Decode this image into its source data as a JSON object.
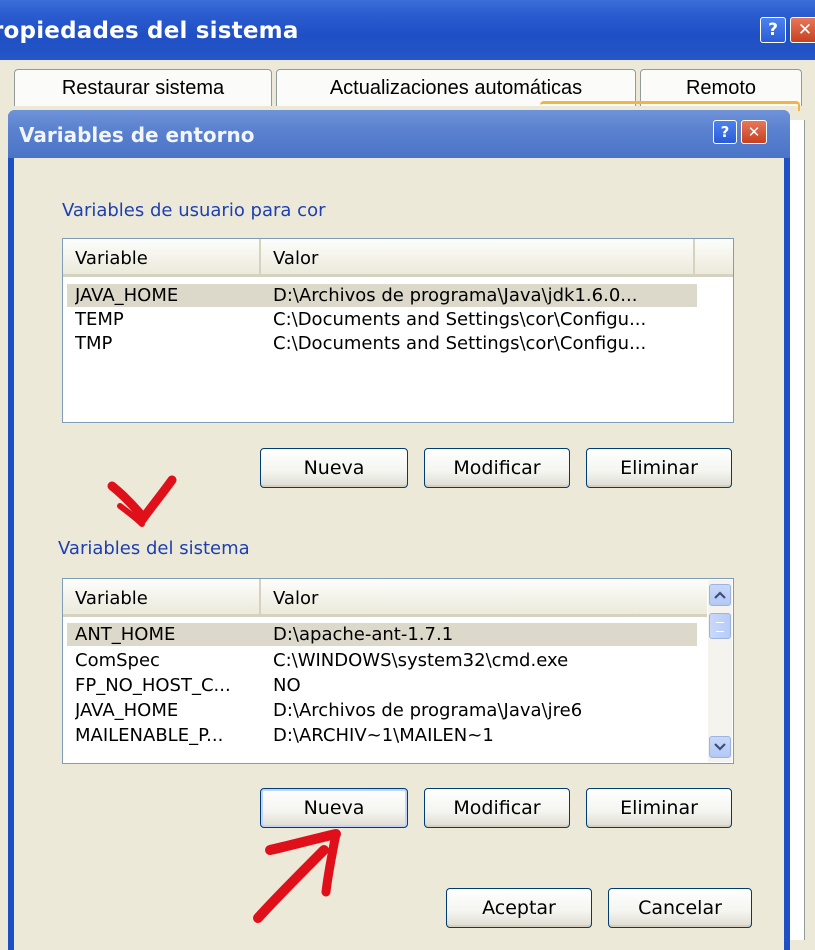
{
  "outer_window": {
    "title": "ropiedades del sistema",
    "help_glyph": "?",
    "close_glyph": "✕",
    "tabs": [
      {
        "label": "Restaurar sistema"
      },
      {
        "label": "Actualizaciones automáticas"
      },
      {
        "label": "Remoto"
      }
    ]
  },
  "dialog": {
    "title": "Variables de entorno",
    "help_glyph": "?",
    "close_glyph": "✕",
    "user_section": {
      "label": "Variables de usuario para cor",
      "columns": [
        "Variable",
        "Valor"
      ],
      "rows": [
        {
          "variable": "JAVA_HOME",
          "valor": "D:\\Archivos de programa\\Java\\jdk1.6.0...",
          "selected": true
        },
        {
          "variable": "TEMP",
          "valor": "C:\\Documents and Settings\\cor\\Configu...",
          "selected": false
        },
        {
          "variable": "TMP",
          "valor": "C:\\Documents and Settings\\cor\\Configu...",
          "selected": false
        }
      ],
      "buttons": {
        "new": "Nueva",
        "edit": "Modificar",
        "delete": "Eliminar"
      }
    },
    "system_section": {
      "label": "Variables del sistema",
      "columns": [
        "Variable",
        "Valor"
      ],
      "rows": [
        {
          "variable": "ANT_HOME",
          "valor": "D:\\apache-ant-1.7.1",
          "selected": true
        },
        {
          "variable": "ComSpec",
          "valor": "C:\\WINDOWS\\system32\\cmd.exe",
          "selected": false
        },
        {
          "variable": "FP_NO_HOST_C...",
          "valor": "NO",
          "selected": false
        },
        {
          "variable": "JAVA_HOME",
          "valor": "D:\\Archivos de programa\\Java\\jre6",
          "selected": false
        },
        {
          "variable": "MAILENABLE_P...",
          "valor": "D:\\ARCHIV~1\\MAILEN~1",
          "selected": false
        }
      ],
      "buttons": {
        "new": "Nueva",
        "edit": "Modificar",
        "delete": "Eliminar"
      }
    },
    "footer_buttons": {
      "ok": "Aceptar",
      "cancel": "Cancelar"
    }
  },
  "colors": {
    "title_bar_blue": "#2a5bcf",
    "dialog_title_blue": "#5b82cf",
    "dialog_face": "#ece9d8",
    "section_label_blue": "#1d3fb0",
    "annotation_red": "#e0101a"
  },
  "icons": {
    "help": "help-icon",
    "close": "close-icon",
    "scroll_up": "chevron-up-icon",
    "scroll_down": "chevron-down-icon",
    "annotation_down": "red-arrow-down-icon",
    "annotation_up": "red-arrow-up-icon"
  }
}
